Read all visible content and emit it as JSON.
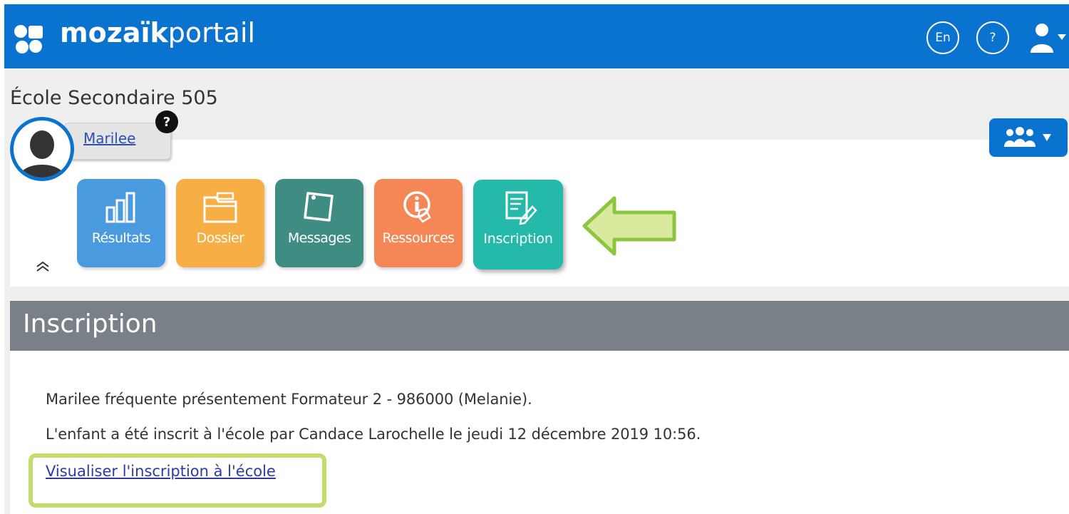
{
  "header": {
    "logo_bold": "mozaïk",
    "logo_light": "portail",
    "language_label": "En",
    "help_label": "?",
    "brand_color": "#0a72cf"
  },
  "school": {
    "name": "École Secondaire 505"
  },
  "student": {
    "name": "Marilee",
    "help_badge": "?"
  },
  "tiles": [
    {
      "label": "Résultats",
      "icon": "bar-chart-icon",
      "color": "#4a9ae0"
    },
    {
      "label": "Dossier",
      "icon": "folder-icon",
      "color": "#f6ae45"
    },
    {
      "label": "Messages",
      "icon": "note-icon",
      "color": "#3f8d82"
    },
    {
      "label": "Ressources",
      "icon": "info-hand-icon",
      "color": "#f58757"
    },
    {
      "label": "Inscription",
      "icon": "form-pencil-icon",
      "color": "#25b9a9"
    }
  ],
  "section": {
    "title": "Inscription",
    "line1": "Marilee fréquente présentement Formateur 2 - 986000 (Melanie).",
    "line2": "L'enfant a été inscrit à l'école par Candace Larochelle le jeudi 12 décembre 2019 10:56.",
    "view_link": "Visualiser l'inscription à l'école"
  },
  "annotations": {
    "arrow_color": "#8cc63f",
    "highlight_color": "#c3dc6e"
  }
}
